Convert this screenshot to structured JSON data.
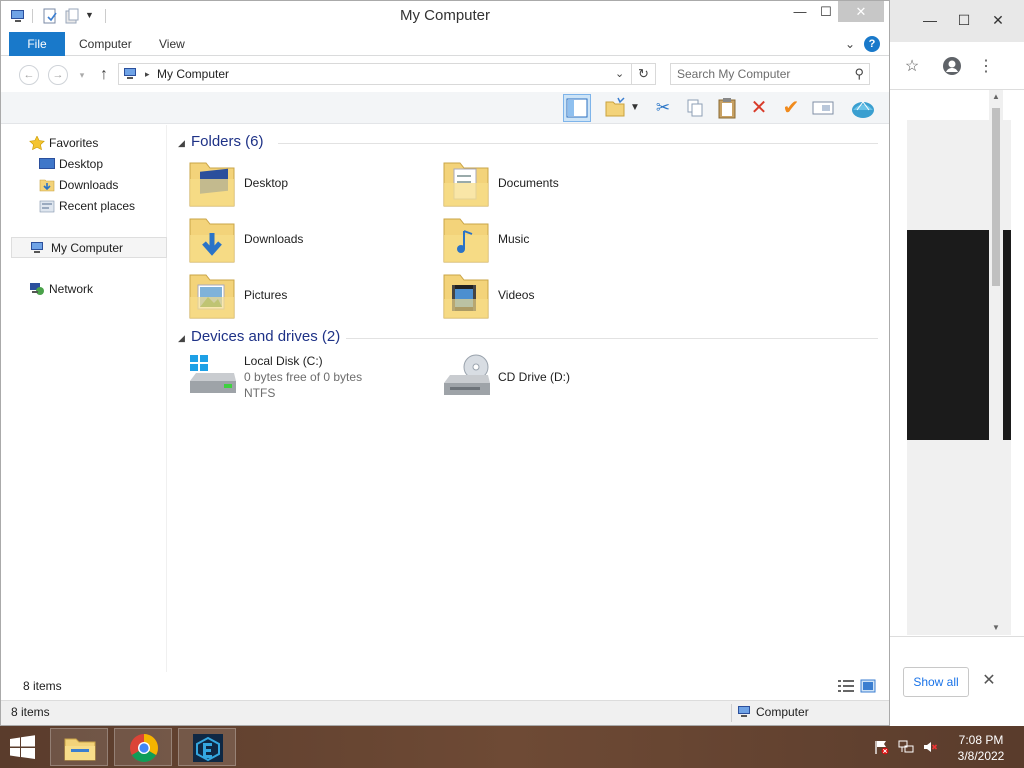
{
  "explorer": {
    "title": "My Computer",
    "qat": {
      "icons": [
        "computer-icon",
        "properties-icon",
        "new-folder-icon",
        "customize-arrow-icon"
      ]
    },
    "window_buttons": {
      "minimize": "—",
      "maximize": "☐",
      "close": "✕"
    },
    "ribbon": {
      "tabs": [
        "File",
        "Computer",
        "View"
      ],
      "expand_icon": "⌄",
      "help_icon": "?"
    },
    "address": {
      "back": "←",
      "forward": "→",
      "recent": "▾",
      "up": "↑",
      "path_sep": "▸",
      "path": "My Computer",
      "dropdown": "⌄",
      "refresh": "↻",
      "search_placeholder": "Search My Computer",
      "search_icon": "⚲"
    },
    "command_bar": {
      "icons": [
        "layout-pane-icon",
        "new-folder-icon",
        "dropdown-arrow-icon",
        "cut-icon",
        "copy-icon",
        "paste-icon",
        "delete-icon",
        "checkmark-icon",
        "rename-icon",
        "shell-icon"
      ]
    },
    "nav_pane": {
      "favorites": "Favorites",
      "favorites_items": [
        "Desktop",
        "Downloads",
        "Recent places"
      ],
      "my_computer": "My Computer",
      "network": "Network"
    },
    "groups": {
      "folders": {
        "title": "Folders (6)",
        "items": [
          "Desktop",
          "Documents",
          "Downloads",
          "Music",
          "Pictures",
          "Videos"
        ]
      },
      "drives": {
        "title": "Devices and drives (2)",
        "local_disk": {
          "name": "Local Disk (C:)",
          "free": "0 bytes free of 0 bytes",
          "fs": "NTFS"
        },
        "cd_drive": {
          "name": "CD Drive (D:)"
        }
      }
    },
    "status": {
      "inner_count": "8 items",
      "outer_count": "8 items",
      "zone": "Computer"
    }
  },
  "background_window": {
    "buttons": {
      "minimize": "—",
      "maximize": "☐",
      "close": "✕"
    },
    "toolbar_icons": [
      "star-icon",
      "account-icon",
      "menu-icon"
    ],
    "toolbar_glyphs": {
      "star": "☆",
      "account": "●",
      "menu": "⋮"
    },
    "show_all": "Show all",
    "close": "✕",
    "scroll": {
      "up": "▲",
      "down": "▼",
      "right": "▸"
    }
  },
  "taskbar": {
    "apps": [
      "file-explorer-icon",
      "chrome-icon",
      "app-icon"
    ],
    "tray_icons": [
      "flag-icon",
      "network-icon",
      "volume-muted-icon"
    ],
    "time": "7:08 PM",
    "date": "3/8/2022"
  }
}
